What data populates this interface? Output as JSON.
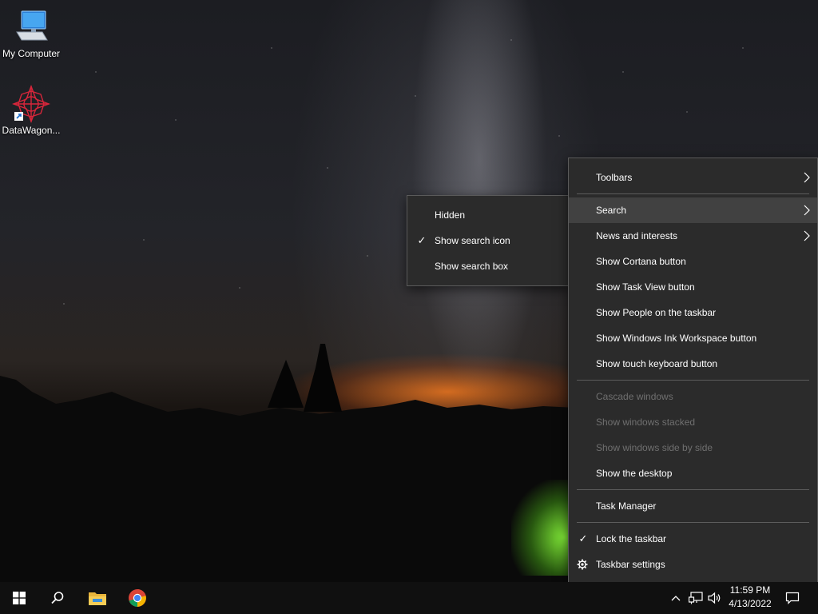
{
  "desktop": {
    "icons": [
      {
        "label": "My Computer",
        "icon": "computer-icon"
      },
      {
        "label": "DataWagon...",
        "icon": "datawagon-shortcut-icon"
      }
    ]
  },
  "context_menu": {
    "items": {
      "toolbars": "Toolbars",
      "search": "Search",
      "news": "News and interests",
      "cortana": "Show Cortana button",
      "taskview": "Show Task View button",
      "people": "Show People on the taskbar",
      "ink": "Show Windows Ink Workspace button",
      "touch_keyboard": "Show touch keyboard button",
      "cascade": "Cascade windows",
      "stacked": "Show windows stacked",
      "side_by_side": "Show windows side by side",
      "show_desktop": "Show the desktop",
      "task_manager": "Task Manager",
      "lock_taskbar": "Lock the taskbar",
      "taskbar_settings": "Taskbar settings"
    },
    "lock_taskbar_checked": true
  },
  "search_submenu": {
    "items": {
      "hidden": "Hidden",
      "show_icon": "Show search icon",
      "show_box": "Show search box"
    },
    "selected": "Show search icon"
  },
  "taskbar": {
    "pinned": [
      "start-icon",
      "search-icon",
      "file-explorer-icon",
      "chrome-icon"
    ],
    "clock": {
      "time": "11:59 PM",
      "date": "4/13/2022"
    },
    "tray": [
      "chevron-up-icon",
      "network-icon",
      "volume-icon",
      "action-center-icon"
    ]
  }
}
